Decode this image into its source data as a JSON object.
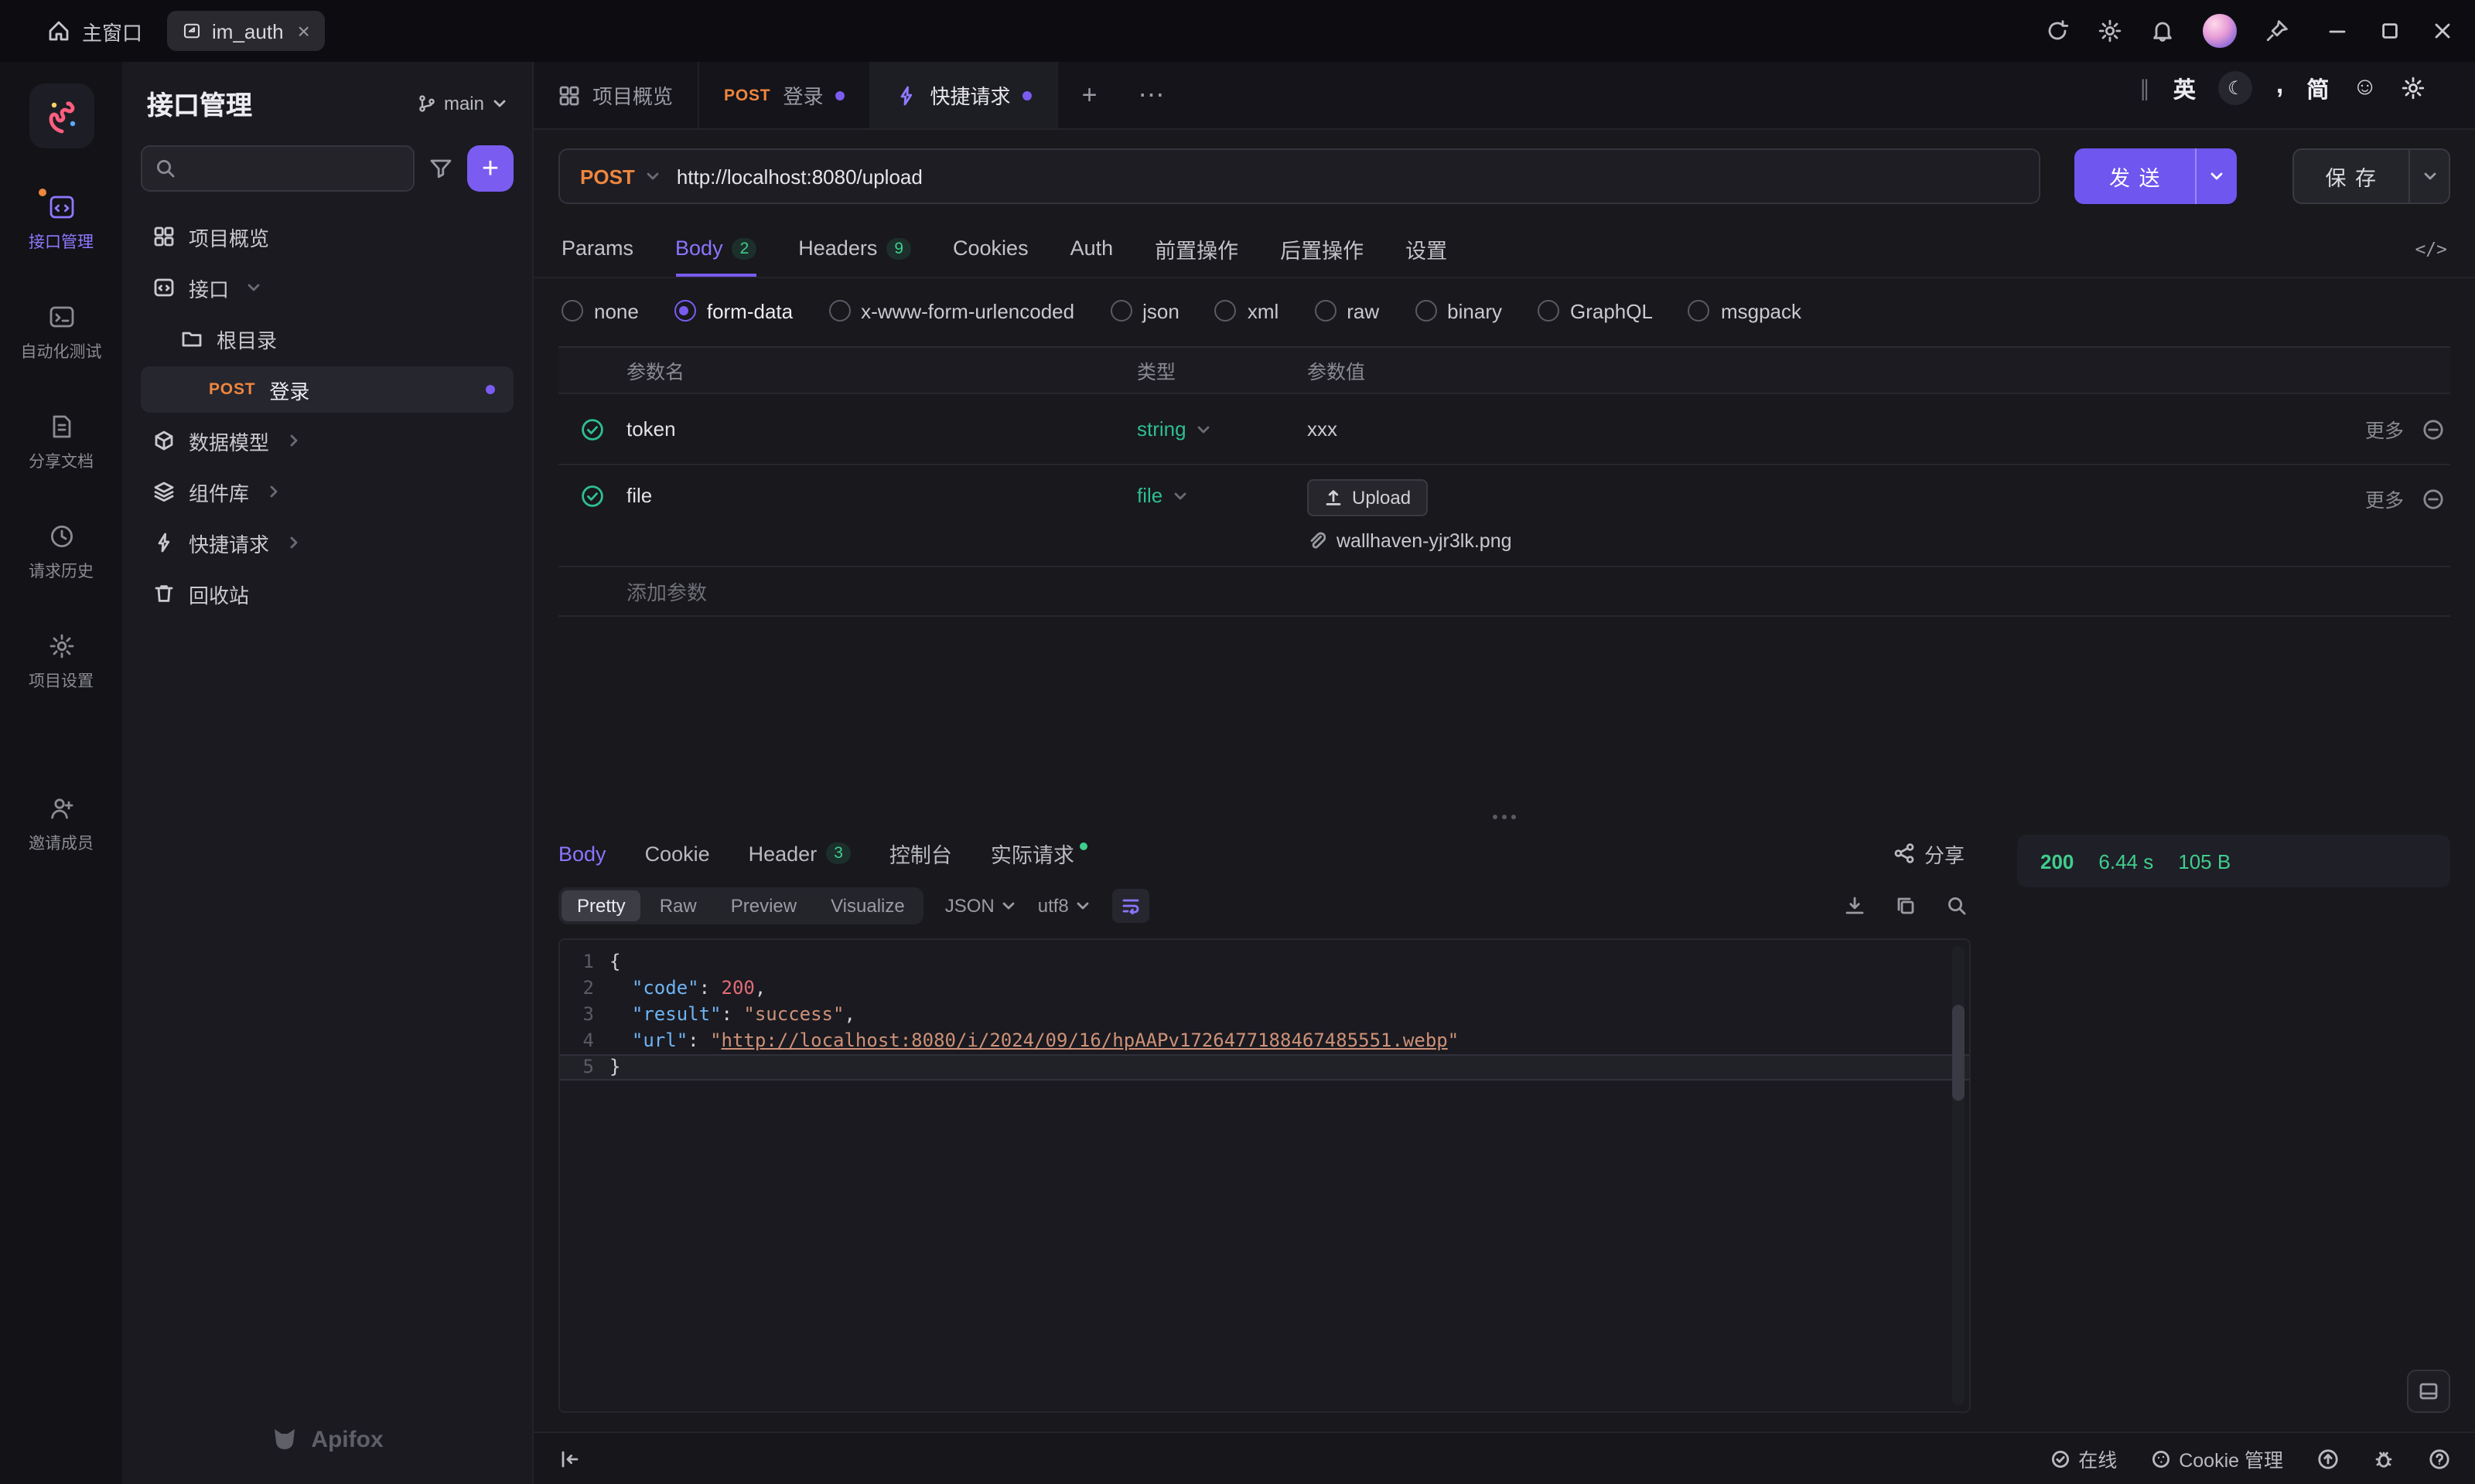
{
  "titlebar": {
    "home": "主窗口",
    "tab_label": "im_auth"
  },
  "ime": {
    "en": "英",
    "comma": ",",
    "jian": "简"
  },
  "iconbar": {
    "items": [
      {
        "label": "接口管理"
      },
      {
        "label": "自动化测试"
      },
      {
        "label": "分享文档"
      },
      {
        "label": "请求历史"
      },
      {
        "label": "项目设置"
      },
      {
        "label": "邀请成员"
      }
    ]
  },
  "sidebar": {
    "title": "接口管理",
    "branch": "main",
    "items": {
      "overview": "项目概览",
      "api": "接口",
      "root": "根目录",
      "login_method": "POST",
      "login": "登录",
      "models": "数据模型",
      "components": "组件库",
      "quick": "快捷请求",
      "trash": "回收站"
    },
    "brand": "Apifox"
  },
  "doc_tabs": {
    "overview": "项目概览",
    "login_method": "POST",
    "login": "登录",
    "quick": "快捷请求"
  },
  "request": {
    "method": "POST",
    "url": "http://localhost:8080/upload",
    "send": "发 送",
    "save": "保 存",
    "tabs": [
      {
        "label": "Params"
      },
      {
        "label": "Body",
        "badge": "2"
      },
      {
        "label": "Headers",
        "badge": "9"
      },
      {
        "label": "Cookies"
      },
      {
        "label": "Auth"
      },
      {
        "label": "前置操作"
      },
      {
        "label": "后置操作"
      },
      {
        "label": "设置"
      }
    ],
    "body_types": [
      "none",
      "form-data",
      "x-www-form-urlencoded",
      "json",
      "xml",
      "raw",
      "binary",
      "GraphQL",
      "msgpack"
    ],
    "selected_body_type": "form-data",
    "table": {
      "col_name": "参数名",
      "col_type": "类型",
      "col_value": "参数值",
      "rows": [
        {
          "name": "token",
          "type": "string",
          "value": "xxx",
          "more": "更多"
        },
        {
          "name": "file",
          "type": "file",
          "upload": "Upload",
          "file": "wallhaven-yjr3lk.png",
          "more": "更多"
        }
      ],
      "add": "添加参数"
    }
  },
  "response": {
    "tabs": {
      "body": "Body",
      "cookie": "Cookie",
      "header": "Header",
      "header_badge": "3",
      "console": "控制台",
      "actual": "实际请求"
    },
    "share": "分享",
    "status": {
      "code": "200",
      "time": "6.44 s",
      "size": "105 B"
    },
    "modes": [
      "Pretty",
      "Raw",
      "Preview",
      "Visualize"
    ],
    "format": "JSON",
    "encoding": "utf8",
    "code": {
      "lines": [
        {
          "num": "1",
          "tokens": [
            {
              "t": "{",
              "c": "p"
            }
          ]
        },
        {
          "num": "2",
          "tokens": [
            {
              "t": "  ",
              "c": "p"
            },
            {
              "t": "\"code\"",
              "c": "k"
            },
            {
              "t": ": ",
              "c": "p"
            },
            {
              "t": "200",
              "c": "n"
            },
            {
              "t": ",",
              "c": "p"
            }
          ]
        },
        {
          "num": "3",
          "tokens": [
            {
              "t": "  ",
              "c": "p"
            },
            {
              "t": "\"result\"",
              "c": "k"
            },
            {
              "t": ": ",
              "c": "p"
            },
            {
              "t": "\"success\"",
              "c": "s"
            },
            {
              "t": ",",
              "c": "p"
            }
          ]
        },
        {
          "num": "4",
          "tokens": [
            {
              "t": "  ",
              "c": "p"
            },
            {
              "t": "\"url\"",
              "c": "k"
            },
            {
              "t": ": ",
              "c": "p"
            },
            {
              "t": "\"",
              "c": "s"
            },
            {
              "t": "http://localhost:8080/i/2024/09/16/hpAAPv1726477188467485551.webp",
              "c": "u"
            },
            {
              "t": "\"",
              "c": "s"
            }
          ]
        },
        {
          "num": "5",
          "tokens": [
            {
              "t": "}",
              "c": "p"
            }
          ]
        }
      ]
    }
  },
  "statusbar": {
    "online": "在线",
    "cookie": "Cookie 管理"
  }
}
